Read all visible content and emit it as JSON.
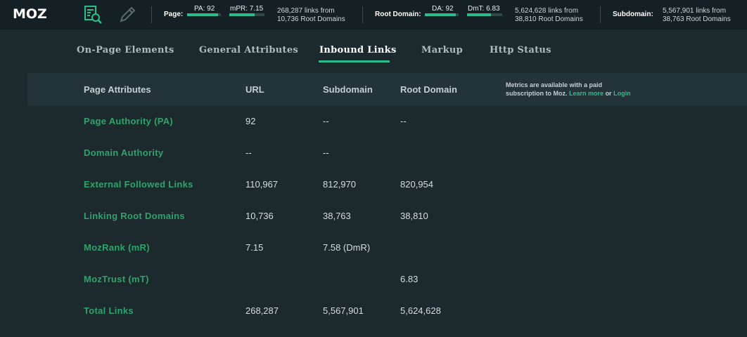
{
  "topbar": {
    "logo": "MOZ",
    "page": {
      "label": "Page:",
      "pa_label": "PA: 92",
      "pa_fill": 0.92,
      "mpr_label": "mPR: 7.15",
      "mpr_fill": 0.715,
      "links_line1": "268,287 links from",
      "links_line2": "10,736 Root Domains"
    },
    "root_domain": {
      "label": "Root Domain:",
      "da_label": "DA: 92",
      "da_fill": 0.92,
      "dmt_label": "DmT: 6.83",
      "dmt_fill": 0.683,
      "links_line1": "5,624,628 links from",
      "links_line2": "38,810 Root Domains"
    },
    "subdomain": {
      "label": "Subdomain:",
      "links_line1": "5,567,901 links from",
      "links_line2": "38,763 Root Domains"
    }
  },
  "tabs": [
    {
      "label": "On-Page Elements",
      "active": false
    },
    {
      "label": "General Attributes",
      "active": false
    },
    {
      "label": "Inbound Links",
      "active": true
    },
    {
      "label": "Markup",
      "active": false
    },
    {
      "label": "Http Status",
      "active": false
    }
  ],
  "table": {
    "headers": [
      "Page Attributes",
      "URL",
      "Subdomain",
      "Root Domain"
    ],
    "notice": {
      "text": "Metrics are available with a paid subscription to Moz.",
      "learn_more": "Learn more",
      "or": "or",
      "login": "Login"
    },
    "rows": [
      {
        "attr": "Page Authority (PA)",
        "url": "92",
        "sub": "--",
        "root": "--"
      },
      {
        "attr": "Domain Authority",
        "url": "--",
        "sub": "--",
        "root": ""
      },
      {
        "attr": "External Followed Links",
        "url": "110,967",
        "sub": "812,970",
        "root": "820,954"
      },
      {
        "attr": "Linking Root Domains",
        "url": "10,736",
        "sub": "38,763",
        "root": "38,810"
      },
      {
        "attr": "MozRank (mR)",
        "url": "7.15",
        "sub": "7.58 (DmR)",
        "root": ""
      },
      {
        "attr": "MozTrust (mT)",
        "url": "",
        "sub": "",
        "root": "6.83"
      },
      {
        "attr": "Total Links",
        "url": "268,287",
        "sub": "5,567,901",
        "root": "5,624,628"
      }
    ]
  },
  "colors": {
    "accent": "#2bbd8e",
    "attr_green": "#2fa36a",
    "background": "#1c2a2e"
  },
  "icons": [
    "search-doc-icon",
    "pencil-icon"
  ]
}
